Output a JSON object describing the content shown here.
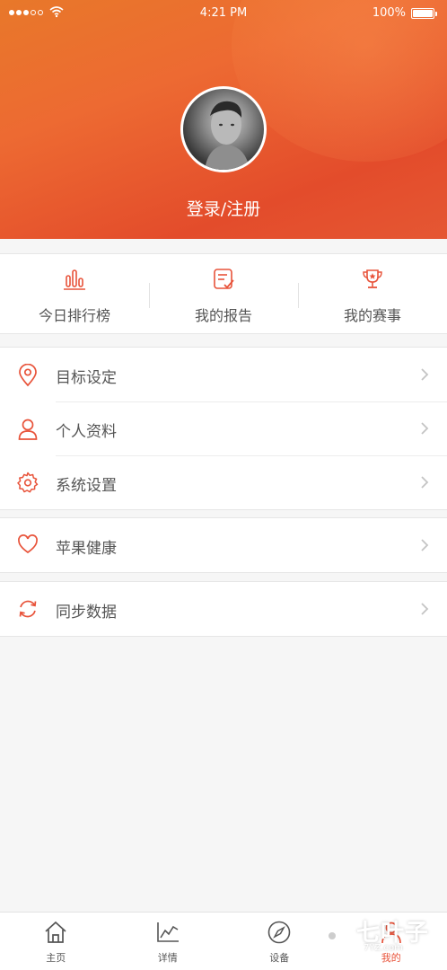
{
  "status_bar": {
    "time": "4:21 PM",
    "battery": "100%"
  },
  "profile": {
    "login_label": "登录/注册"
  },
  "quick_links": [
    {
      "label": "今日排行榜",
      "icon": "bar-chart-icon"
    },
    {
      "label": "我的报告",
      "icon": "report-icon"
    },
    {
      "label": "我的赛事",
      "icon": "trophy-icon"
    }
  ],
  "menu": {
    "group1": [
      {
        "label": "目标设定",
        "icon": "location-pin-icon"
      },
      {
        "label": "个人资料",
        "icon": "user-icon"
      },
      {
        "label": "系统设置",
        "icon": "gear-icon"
      }
    ],
    "group2": [
      {
        "label": "苹果健康",
        "icon": "heart-icon"
      }
    ],
    "group3": [
      {
        "label": "同步数据",
        "icon": "sync-icon"
      }
    ]
  },
  "tabs": [
    {
      "label": "主页",
      "icon": "home-icon",
      "active": false
    },
    {
      "label": "详情",
      "icon": "line-chart-icon",
      "active": false
    },
    {
      "label": "设备",
      "icon": "compass-icon",
      "active": false
    },
    {
      "label": "我的",
      "icon": "profile-icon",
      "active": true
    }
  ],
  "watermark": {
    "text": "七叶子",
    "sub": "7YZ.com"
  },
  "colors": {
    "accent": "#e8533a",
    "header_start": "#e8782a",
    "header_end": "#e34c2b"
  }
}
